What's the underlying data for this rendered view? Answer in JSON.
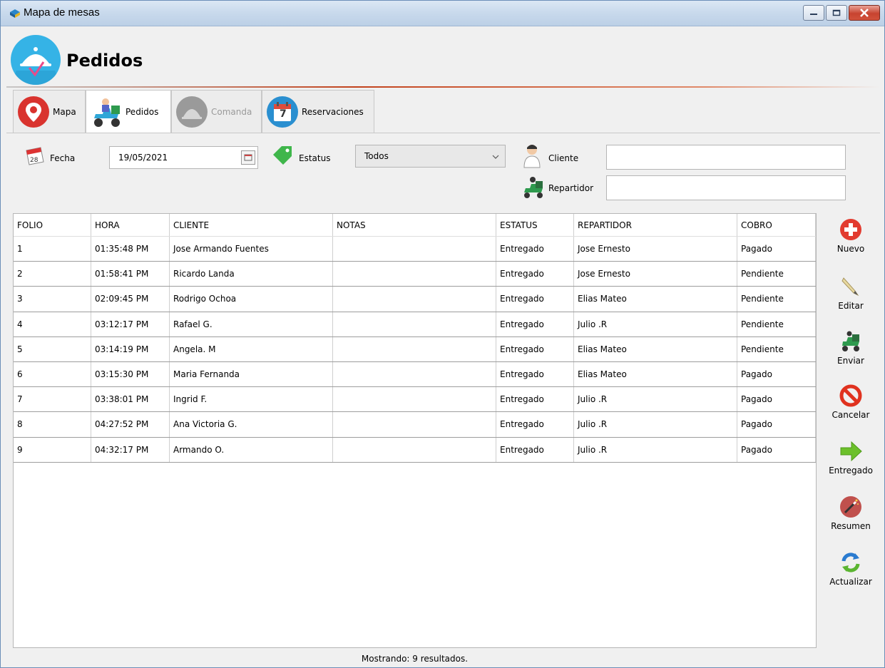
{
  "window": {
    "title": "Mapa de mesas"
  },
  "header": {
    "title": "Pedidos"
  },
  "tabs": [
    {
      "label": "Mapa",
      "icon": "location-pin-icon"
    },
    {
      "label": "Pedidos",
      "icon": "delivery-scooter-icon"
    },
    {
      "label": "Comanda",
      "icon": "serving-bell-icon"
    },
    {
      "label": "Reservaciones",
      "icon": "calendar-icon",
      "day": "7"
    }
  ],
  "filters": {
    "fecha_label": "Fecha",
    "fecha_value": "19/05/2021",
    "estatus_label": "Estatus",
    "estatus_value": "Todos",
    "cliente_label": "Cliente",
    "cliente_value": "",
    "repartidor_label": "Repartidor",
    "repartidor_value": ""
  },
  "table": {
    "columns": [
      "FOLIO",
      "HORA",
      "CLIENTE",
      "NOTAS",
      "ESTATUS",
      "REPARTIDOR",
      "COBRO"
    ],
    "rows": [
      [
        "1",
        "01:35:48 PM",
        "Jose Armando Fuentes",
        "",
        "Entregado",
        "Jose Ernesto",
        "Pagado"
      ],
      [
        "2",
        "01:58:41 PM",
        "Ricardo Landa",
        "",
        "Entregado",
        "Jose Ernesto",
        "Pendiente"
      ],
      [
        "3",
        "02:09:45 PM",
        "Rodrigo Ochoa",
        "",
        "Entregado",
        "Elias Mateo",
        "Pendiente"
      ],
      [
        "4",
        "03:12:17 PM",
        "Rafael G.",
        "",
        "Entregado",
        "Julio .R",
        "Pendiente"
      ],
      [
        "5",
        "03:14:19 PM",
        "Angela. M",
        "",
        "Entregado",
        "Elias Mateo",
        "Pendiente"
      ],
      [
        "6",
        "03:15:30 PM",
        "Maria Fernanda",
        "",
        "Entregado",
        "Elias Mateo",
        "Pagado"
      ],
      [
        "7",
        "03:38:01 PM",
        "Ingrid F.",
        "",
        "Entregado",
        "Julio .R",
        "Pagado"
      ],
      [
        "8",
        "04:27:52 PM",
        "Ana Victoria G.",
        "",
        "Entregado",
        "Julio .R",
        "Pagado"
      ],
      [
        "9",
        "04:32:17 PM",
        "Armando O.",
        "",
        "Entregado",
        "Julio .R",
        "Pagado"
      ]
    ]
  },
  "status_text": "Mostrando: 9 resultados.",
  "actions": [
    {
      "label": "Nuevo",
      "icon": "plus-circle-icon"
    },
    {
      "label": "Editar",
      "icon": "pencil-icon"
    },
    {
      "label": "Enviar",
      "icon": "delivery-scooter-icon"
    },
    {
      "label": "Cancelar",
      "icon": "cancel-icon"
    },
    {
      "label": "Entregado",
      "icon": "arrow-right-icon"
    },
    {
      "label": "Resumen",
      "icon": "magic-wand-icon"
    },
    {
      "label": "Actualizar",
      "icon": "refresh-icon"
    }
  ],
  "colors": {
    "accent_line": "#c2421c",
    "logo_blue": "#35b3e6",
    "map_red": "#d9332e",
    "nuevo_red": "#e23b2f",
    "arrow_green": "#6cc02b"
  }
}
